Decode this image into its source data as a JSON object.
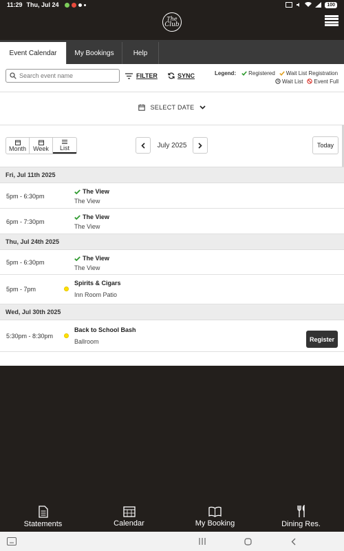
{
  "status_bar": {
    "time": "11:29",
    "date": "Thu, Jul 24",
    "battery": "100"
  },
  "header": {
    "logo_line1": "The",
    "logo_line2": "Club"
  },
  "tabs": [
    {
      "label": "Event Calendar",
      "active": true
    },
    {
      "label": "My Bookings",
      "active": false
    },
    {
      "label": "Help",
      "active": false
    }
  ],
  "toolbar": {
    "search_placeholder": "Search event name",
    "filter_label": "FILTER",
    "sync_label": "SYNC"
  },
  "legend": {
    "title": "Legend:",
    "registered": "Registered",
    "wait_list_registration": "Wait List Registration",
    "wait_list": "Wait List",
    "event_full": "Event Full"
  },
  "date_select": {
    "label": "SELECT DATE"
  },
  "views": {
    "month": "Month",
    "week": "Week",
    "list": "List"
  },
  "calendar": {
    "month_label": "July 2025",
    "today_label": "Today"
  },
  "days": [
    {
      "header": "Fri, Jul 11th 2025",
      "events": [
        {
          "time": "5pm - 6:30pm",
          "title": "The View",
          "location": "The View",
          "status": "registered"
        },
        {
          "time": "6pm - 7:30pm",
          "title": "The View",
          "location": "The View",
          "status": "registered"
        }
      ]
    },
    {
      "header": "Thu, Jul 24th 2025",
      "events": [
        {
          "time": "5pm - 6:30pm",
          "title": "The View",
          "location": "The View",
          "status": "registered"
        },
        {
          "time": "5pm - 7pm",
          "title": "Spirits & Cigars",
          "location": "Inn Room Patio",
          "status": "open"
        }
      ]
    },
    {
      "header": "Wed, Jul 30th 2025",
      "events": [
        {
          "time": "5:30pm - 8:30pm",
          "title": "Back to School Bash",
          "location": "Ballroom",
          "status": "open",
          "action": "Register"
        }
      ]
    }
  ],
  "bottom_nav": {
    "statements": "Statements",
    "calendar": "Calendar",
    "my_booking": "My Booking",
    "dining": "Dining Res."
  },
  "colors": {
    "dark_bg": "#231f1c",
    "tab_bg": "#3a3a3a",
    "registered_green": "#2e9a2e",
    "waitlist_orange": "#e0a020",
    "event_full_red": "#d9342b",
    "open_yellow": "#ffe000"
  }
}
